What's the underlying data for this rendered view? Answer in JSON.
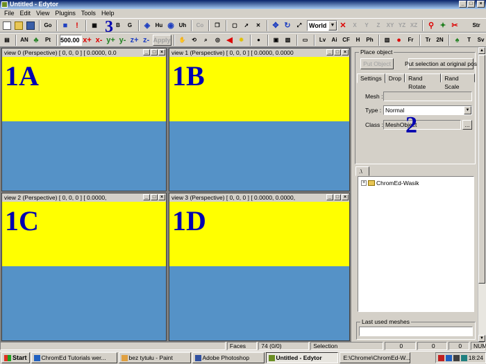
{
  "window": {
    "title": "Untitled - Edytor",
    "controls": [
      "_",
      "□",
      "×"
    ]
  },
  "menu": [
    "File",
    "Edit",
    "View",
    "Plugins",
    "Tools",
    "Help"
  ],
  "toolbar1": {
    "labels": {
      "go": "Go",
      "b": "B",
      "g": "G",
      "hu": "Hu",
      "uh": "Uh",
      "co": "Co",
      "x": "X",
      "y": "Y",
      "z": "Z",
      "xy": "XY",
      "yz": "YZ",
      "xz": "XZ",
      "str": "Str"
    },
    "coord_space": "World"
  },
  "toolbar2": {
    "labels": {
      "an": "AN",
      "pt": "Pt",
      "xplus": "x+",
      "xminus": "x-",
      "yplus": "y+",
      "yminus": "y-",
      "zplus": "z+",
      "zminus": "z-",
      "lv": "Lv",
      "ai": "Ai",
      "cf": "CF",
      "h": "H",
      "ph": "Ph",
      "fr": "Fr",
      "tr": "Tr",
      "twon": "2N",
      "t": "T",
      "sv": "Sv"
    },
    "step_value": "500.00",
    "apply": "Apply"
  },
  "viewports": [
    {
      "header": "view 0 (Perspective) [      0,       0,       0 ] [ 0.0000, 0.0",
      "label": "1A"
    },
    {
      "header": "view 1 (Perspective) [      0,       0,       0 ] [ 0.0000, 0.0000",
      "label": "1B"
    },
    {
      "header": "view 2 (Perspective) [      0,       0,       0 ] [ 0.0000,",
      "label": "1C"
    },
    {
      "header": "view 3 (Perspective) [      0,       0,       0 ] [ 0.0000, 0.0000,",
      "label": "1D"
    }
  ],
  "place_object": {
    "group_label": "Place object",
    "put_object": "Put Object",
    "put_selection": "Put selection at original pos",
    "tabs": [
      "Settings",
      "Drop",
      "Rand Rotate",
      "Rand Scale"
    ],
    "mesh_label": "Mesh :",
    "mesh_value": "",
    "type_label": "Type :",
    "type_value": "Normal",
    "class_label": "Class :",
    "class_value": "MeshObject",
    "browse": "..."
  },
  "tree": {
    "tab": ".\\",
    "root_item": "ChromEd-Wasik"
  },
  "last_used": {
    "label": "Last used meshes"
  },
  "annotations": {
    "n2": "2",
    "n3": "3"
  },
  "status": {
    "faces_label": "Faces",
    "faces_value": "74 (0/0)",
    "selection": "Selection",
    "v1": "0",
    "v2": "0",
    "v3": "0",
    "num": "NUM"
  },
  "taskbar": {
    "start": "Start",
    "items": [
      "ChromEd Tutorials wer...",
      "bez tytułu - Paint",
      "Adobe Photoshop",
      "Untitled - Edytor",
      "E:\\Chrome\\ChromEd-W..."
    ],
    "clock": "18:24"
  },
  "colors": {
    "viewport_top": "#ffff00",
    "viewport_bottom": "#5592c7",
    "annotation": "#0000b0",
    "titlebar": "#0a246a"
  }
}
